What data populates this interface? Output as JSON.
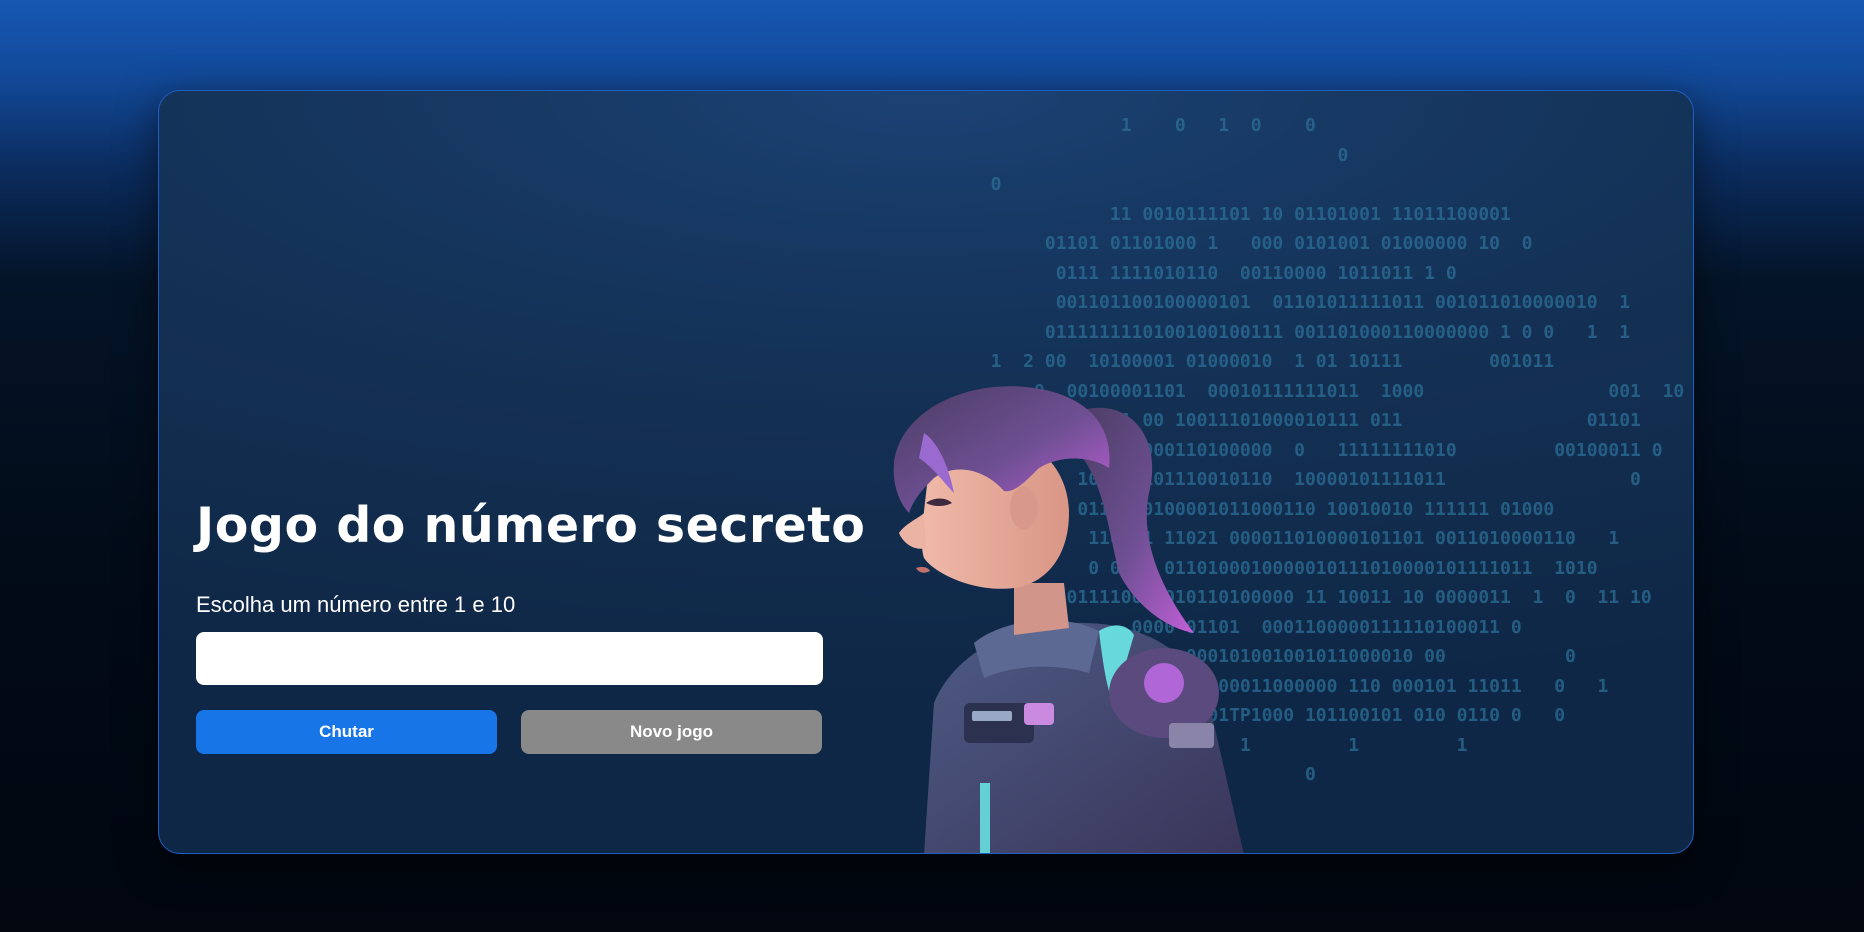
{
  "game": {
    "title": "Jogo do número secreto",
    "instruction": "Escolha um número entre 1 e 10",
    "input_value": "",
    "guess_button": "Chutar",
    "new_game_button": "Novo jogo"
  },
  "background": {
    "binary_lines": [
      "              1    0   1  0    0",
      "                                  0",
      "  0",
      "             11 0010111101 10 01101001 11011100001",
      "       01101 01101000 1   000 0101001 01000000 10  0",
      "        0111 1111010110  00110000 1011011 1 0",
      "        001101100100000101  01101011111011 001011010000010  1",
      "       0111111110100100100111 001101000110000000 1 0 0   1  1",
      "  1  2 00  10100001 01000010  1 01 10111        001011",
      "      0  00100001101  00010111111011  1000                 001  10 0",
      "          10001 00 10011101000010111 011                 01101",
      "         0100100000110100000  0   11111111010         00100011 0",
      "          10 000101110010110  10000101111011                 0",
      "          01101 0100001011000110 10010010 111111 01000",
      "           110001 11021 000011010000101101 0011010000110   1",
      "           0 000  0110100010000010111010000101111011  1010",
      "         011110000010110100000 11 10011 10 0000011  1  0  11 10",
      "               0000 01101  0001100000111110100011 0",
      "               0011 000101001001011000010 00           0",
      "         011    101101 00011000000 110 000101 11011   0   1",
      "          00 010 1110101TP1000 101100101 010 0110 0   0",
      "                    1    1         1         1",
      "                               0"
    ]
  },
  "icons": {
    "astronaut": "astronaut-girl-illustration"
  },
  "colors": {
    "accent": "#1875e8",
    "secondary_button": "#898989",
    "frame_border": "#1f5fc4"
  }
}
